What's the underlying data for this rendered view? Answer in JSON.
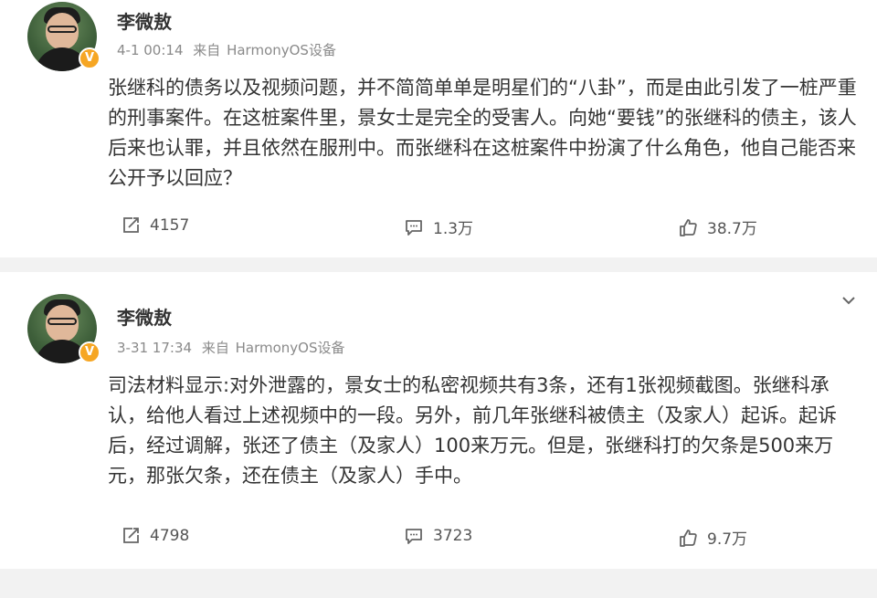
{
  "posts": [
    {
      "author": "李微敖",
      "time": "4-1 00:14",
      "source_prefix": "来自",
      "source": "HarmonyOS设备",
      "content": "张继科的债务以及视频问题，并不简简单单是明星们的“八卦”，而是由此引发了一桩严重的刑事案件。在这桩案件里，景女士是完全的受害人。向她“要钱”的张继科的债主，该人后来也认罪，并且依然在服刑中。而张继科在这桩案件中扮演了什么角色，他自己能否来公开予以回应？",
      "reposts": "4157",
      "comments": "1.3万",
      "likes": "38.7万"
    },
    {
      "author": "李微敖",
      "time": "3-31 17:34",
      "source_prefix": "来自",
      "source": "HarmonyOS设备",
      "content": "司法材料显示:对外泄露的，景女士的私密视频共有3条，还有1张视频截图。张继科承认，给他人看过上述视频中的一段。另外，前几年张继科被债主（及家人）起诉。起诉后，经过调解，张还了债主（及家人）100来万元。但是，张继科打的欠条是500来万元，那张欠条，还在债主（及家人）手中。",
      "reposts": "4798",
      "comments": "3723",
      "likes": "9.7万"
    }
  ],
  "icons": {
    "verified": "v-badge-icon",
    "repost": "repost-icon",
    "comment": "comment-icon",
    "like": "thumbs-up-icon",
    "more": "chevron-down-icon"
  },
  "colors": {
    "badge": "#f6a623",
    "background": "#f2f2f2",
    "text": "#333333",
    "meta": "#8a8a8a"
  }
}
